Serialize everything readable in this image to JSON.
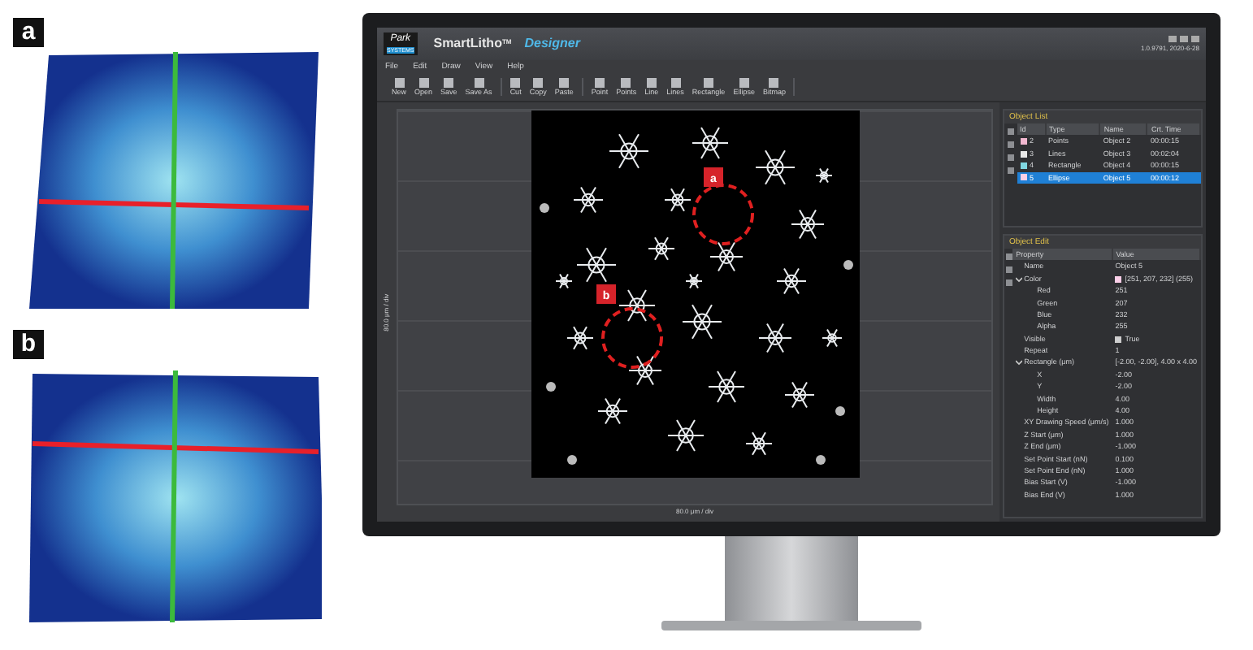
{
  "figure_panels": [
    {
      "label": "a"
    },
    {
      "label": "b"
    }
  ],
  "app": {
    "logo": "Park",
    "logo_sub": "SYSTEMS",
    "title": "SmartLitho",
    "title_sup": "TM",
    "subtitle": "Designer",
    "version": "1.0.9791, 2020-6-28",
    "menu": [
      "File",
      "Edit",
      "Draw",
      "View",
      "Help"
    ],
    "toolbar_groups": [
      [
        "New",
        "Open",
        "Save",
        "Save As"
      ],
      [
        "Cut",
        "Copy",
        "Paste"
      ],
      [
        "Point",
        "Points",
        "Line",
        "Lines",
        "Rectangle",
        "Ellipse",
        "Bitmap"
      ]
    ],
    "canvas": {
      "y_axis_label": "80.0 μm / div",
      "x_axis_label": "80.0 μm / div",
      "markers": [
        {
          "label": "a"
        },
        {
          "label": "b"
        }
      ]
    },
    "object_list": {
      "title": "Object List",
      "columns": [
        "Id",
        "Type",
        "Name",
        "Crt. Time"
      ],
      "rows": [
        {
          "id": "2",
          "type": "Points",
          "name": "Object 2",
          "time": "00:00:15",
          "color": "#f2b8d0",
          "selected": false
        },
        {
          "id": "3",
          "type": "Lines",
          "name": "Object 3",
          "time": "00:02:04",
          "color": "#e8e8e8",
          "selected": false
        },
        {
          "id": "4",
          "type": "Rectangle",
          "name": "Object 4",
          "time": "00:00:15",
          "color": "#7fd6e0",
          "selected": false
        },
        {
          "id": "5",
          "type": "Ellipse",
          "name": "Object 5",
          "time": "00:00:12",
          "color": "#fbcfe8",
          "selected": true
        }
      ]
    },
    "object_edit": {
      "title": "Object Edit",
      "columns": [
        "Property",
        "Value"
      ],
      "rows": [
        {
          "name": "Name",
          "value": "Object 5"
        },
        {
          "name": "Color",
          "value": "[251, 207, 232] (255)",
          "color": "#fbcfe8",
          "expanded": true,
          "children": [
            {
              "name": "Red",
              "value": "251"
            },
            {
              "name": "Green",
              "value": "207"
            },
            {
              "name": "Blue",
              "value": "232"
            },
            {
              "name": "Alpha",
              "value": "255"
            }
          ]
        },
        {
          "name": "Visible",
          "value": "True",
          "checked": true
        },
        {
          "name": "Repeat",
          "value": "1"
        },
        {
          "name": "Rectangle (μm)",
          "value": "[-2.00, -2.00], 4.00 x 4.00",
          "expanded": true,
          "children": [
            {
              "name": "X",
              "value": "-2.00"
            },
            {
              "name": "Y",
              "value": "-2.00"
            },
            {
              "name": "Width",
              "value": "4.00"
            },
            {
              "name": "Height",
              "value": "4.00"
            }
          ]
        },
        {
          "name": "XY Drawing Speed (μm/s)",
          "value": "1.000"
        },
        {
          "name": "Z Start (μm)",
          "value": "1.000"
        },
        {
          "name": "Z End (μm)",
          "value": "-1.000"
        },
        {
          "name": "Set Point Start (nN)",
          "value": "0.100"
        },
        {
          "name": "Set Point End (nN)",
          "value": "1.000"
        },
        {
          "name": "Bias Start (V)",
          "value": "-1.000"
        },
        {
          "name": "Bias End (V)",
          "value": "1.000"
        }
      ]
    }
  }
}
